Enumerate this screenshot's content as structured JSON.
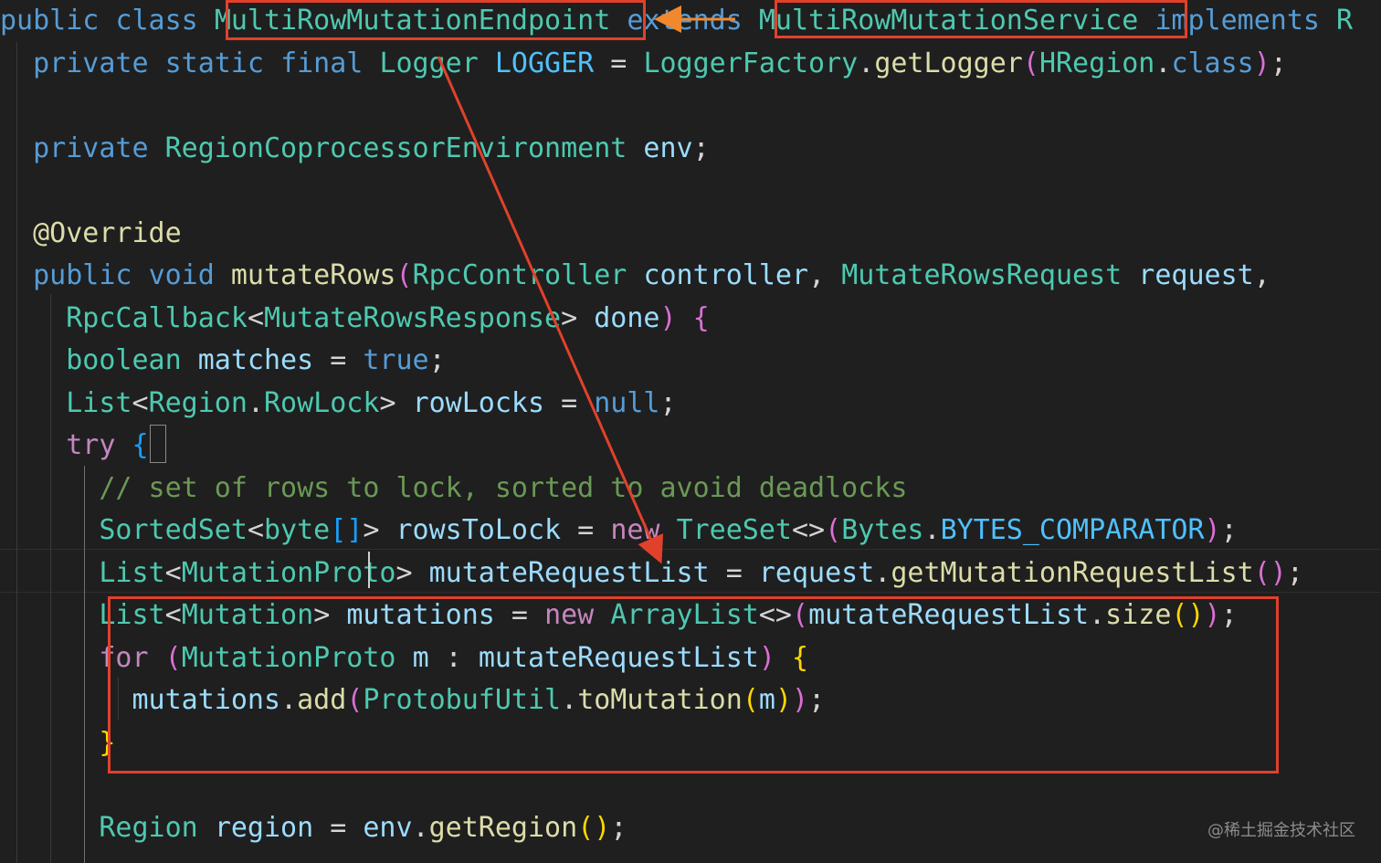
{
  "editor": {
    "cursor_line_index": 13,
    "lines": [
      {
        "tokens": [
          {
            "t": "public",
            "c": "kw"
          },
          {
            "t": " "
          },
          {
            "t": "class",
            "c": "kw"
          },
          {
            "t": " "
          },
          {
            "t": "MultiRowMutationEndpoint",
            "c": "type"
          },
          {
            "t": " "
          },
          {
            "t": "extends",
            "c": "kw"
          },
          {
            "t": " "
          },
          {
            "t": "MultiRowMutationService",
            "c": "type"
          },
          {
            "t": " "
          },
          {
            "t": "implements",
            "c": "kw"
          },
          {
            "t": " "
          },
          {
            "t": "R",
            "c": "type"
          }
        ]
      },
      {
        "tokens": [
          {
            "t": "  "
          },
          {
            "t": "private",
            "c": "kw"
          },
          {
            "t": " "
          },
          {
            "t": "static",
            "c": "kw"
          },
          {
            "t": " "
          },
          {
            "t": "final",
            "c": "kw"
          },
          {
            "t": " "
          },
          {
            "t": "Logger",
            "c": "type"
          },
          {
            "t": " "
          },
          {
            "t": "LOGGER",
            "c": "const"
          },
          {
            "t": " = ",
            "c": "pun"
          },
          {
            "t": "LoggerFactory",
            "c": "type"
          },
          {
            "t": ".",
            "c": "pun"
          },
          {
            "t": "getLogger",
            "c": "fn"
          },
          {
            "t": "(",
            "c": "b1"
          },
          {
            "t": "HRegion",
            "c": "type"
          },
          {
            "t": ".",
            "c": "pun"
          },
          {
            "t": "class",
            "c": "kw"
          },
          {
            "t": ")",
            "c": "b1"
          },
          {
            "t": ";",
            "c": "pun"
          }
        ]
      },
      {
        "tokens": []
      },
      {
        "tokens": [
          {
            "t": "  "
          },
          {
            "t": "private",
            "c": "kw"
          },
          {
            "t": " "
          },
          {
            "t": "RegionCoprocessorEnvironment",
            "c": "type"
          },
          {
            "t": " "
          },
          {
            "t": "env",
            "c": "var"
          },
          {
            "t": ";",
            "c": "pun"
          }
        ]
      },
      {
        "tokens": []
      },
      {
        "tokens": [
          {
            "t": "  "
          },
          {
            "t": "@Override",
            "c": "anno"
          }
        ]
      },
      {
        "tokens": [
          {
            "t": "  "
          },
          {
            "t": "public",
            "c": "kw"
          },
          {
            "t": " "
          },
          {
            "t": "void",
            "c": "kw"
          },
          {
            "t": " "
          },
          {
            "t": "mutateRows",
            "c": "fn"
          },
          {
            "t": "(",
            "c": "b1"
          },
          {
            "t": "RpcController",
            "c": "type"
          },
          {
            "t": " "
          },
          {
            "t": "controller",
            "c": "var"
          },
          {
            "t": ", ",
            "c": "pun"
          },
          {
            "t": "MutateRowsRequest",
            "c": "type"
          },
          {
            "t": " "
          },
          {
            "t": "request",
            "c": "var"
          },
          {
            "t": ",",
            "c": "pun"
          }
        ]
      },
      {
        "tokens": [
          {
            "t": "    "
          },
          {
            "t": "RpcCallback",
            "c": "type"
          },
          {
            "t": "<",
            "c": "pun"
          },
          {
            "t": "MutateRowsResponse",
            "c": "type"
          },
          {
            "t": "> ",
            "c": "pun"
          },
          {
            "t": "done",
            "c": "var"
          },
          {
            "t": ")",
            "c": "b1"
          },
          {
            "t": " "
          },
          {
            "t": "{",
            "c": "b1"
          }
        ]
      },
      {
        "tokens": [
          {
            "t": "    "
          },
          {
            "t": "boolean",
            "c": "type"
          },
          {
            "t": " "
          },
          {
            "t": "matches",
            "c": "var"
          },
          {
            "t": " = ",
            "c": "pun"
          },
          {
            "t": "true",
            "c": "kw"
          },
          {
            "t": ";",
            "c": "pun"
          }
        ]
      },
      {
        "tokens": [
          {
            "t": "    "
          },
          {
            "t": "List",
            "c": "type"
          },
          {
            "t": "<",
            "c": "pun"
          },
          {
            "t": "Region",
            "c": "type"
          },
          {
            "t": ".",
            "c": "pun"
          },
          {
            "t": "RowLock",
            "c": "type"
          },
          {
            "t": "> ",
            "c": "pun"
          },
          {
            "t": "rowLocks",
            "c": "var"
          },
          {
            "t": " = ",
            "c": "pun"
          },
          {
            "t": "null",
            "c": "kw"
          },
          {
            "t": ";",
            "c": "pun"
          }
        ]
      },
      {
        "tokens": [
          {
            "t": "    "
          },
          {
            "t": "try",
            "c": "ctrl"
          },
          {
            "t": " "
          },
          {
            "t": "{",
            "c": "b3"
          }
        ]
      },
      {
        "tokens": [
          {
            "t": "      "
          },
          {
            "t": "// set of rows to lock, sorted to avoid deadlocks",
            "c": "cmt"
          }
        ]
      },
      {
        "tokens": [
          {
            "t": "      "
          },
          {
            "t": "SortedSet",
            "c": "type"
          },
          {
            "t": "<",
            "c": "pun"
          },
          {
            "t": "byte",
            "c": "type"
          },
          {
            "t": "[]",
            "c": "b3"
          },
          {
            "t": "> ",
            "c": "pun"
          },
          {
            "t": "rowsToLock",
            "c": "var"
          },
          {
            "t": " = ",
            "c": "pun"
          },
          {
            "t": "new",
            "c": "ctrl"
          },
          {
            "t": " "
          },
          {
            "t": "TreeSet",
            "c": "type"
          },
          {
            "t": "<>",
            "c": "pun"
          },
          {
            "t": "(",
            "c": "b1"
          },
          {
            "t": "Bytes",
            "c": "type"
          },
          {
            "t": ".",
            "c": "pun"
          },
          {
            "t": "BYTES_COMPARATOR",
            "c": "const"
          },
          {
            "t": ")",
            "c": "b1"
          },
          {
            "t": ";",
            "c": "pun"
          }
        ]
      },
      {
        "tokens": [
          {
            "t": "      "
          },
          {
            "t": "List",
            "c": "type"
          },
          {
            "t": "<",
            "c": "pun"
          },
          {
            "t": "MutationProto",
            "c": "type"
          },
          {
            "t": "> ",
            "c": "pun"
          },
          {
            "t": "mutateRequestList",
            "c": "var"
          },
          {
            "t": " = ",
            "c": "pun"
          },
          {
            "t": "request",
            "c": "var"
          },
          {
            "t": ".",
            "c": "pun"
          },
          {
            "t": "getMutationRequestList",
            "c": "fn"
          },
          {
            "t": "()",
            "c": "b1"
          },
          {
            "t": ";",
            "c": "pun"
          }
        ]
      },
      {
        "tokens": [
          {
            "t": "      "
          },
          {
            "t": "List",
            "c": "type"
          },
          {
            "t": "<",
            "c": "pun"
          },
          {
            "t": "Mutation",
            "c": "type"
          },
          {
            "t": "> ",
            "c": "pun"
          },
          {
            "t": "mutations",
            "c": "var"
          },
          {
            "t": " = ",
            "c": "pun"
          },
          {
            "t": "new",
            "c": "ctrl"
          },
          {
            "t": " "
          },
          {
            "t": "ArrayList",
            "c": "type"
          },
          {
            "t": "<>",
            "c": "pun"
          },
          {
            "t": "(",
            "c": "b1"
          },
          {
            "t": "mutateRequestList",
            "c": "var"
          },
          {
            "t": ".",
            "c": "pun"
          },
          {
            "t": "size",
            "c": "fn"
          },
          {
            "t": "()",
            "c": "b2"
          },
          {
            "t": ")",
            "c": "b1"
          },
          {
            "t": ";",
            "c": "pun"
          }
        ]
      },
      {
        "tokens": [
          {
            "t": "      "
          },
          {
            "t": "for",
            "c": "ctrl"
          },
          {
            "t": " "
          },
          {
            "t": "(",
            "c": "b1"
          },
          {
            "t": "MutationProto",
            "c": "type"
          },
          {
            "t": " "
          },
          {
            "t": "m",
            "c": "var"
          },
          {
            "t": " : ",
            "c": "pun"
          },
          {
            "t": "mutateRequestList",
            "c": "var"
          },
          {
            "t": ")",
            "c": "b1"
          },
          {
            "t": " "
          },
          {
            "t": "{",
            "c": "b2"
          }
        ]
      },
      {
        "tokens": [
          {
            "t": "        "
          },
          {
            "t": "mutations",
            "c": "var"
          },
          {
            "t": ".",
            "c": "pun"
          },
          {
            "t": "add",
            "c": "fn"
          },
          {
            "t": "(",
            "c": "b1"
          },
          {
            "t": "ProtobufUtil",
            "c": "type"
          },
          {
            "t": ".",
            "c": "pun"
          },
          {
            "t": "toMutation",
            "c": "fn"
          },
          {
            "t": "(",
            "c": "b2"
          },
          {
            "t": "m",
            "c": "var"
          },
          {
            "t": ")",
            "c": "b2"
          },
          {
            "t": ")",
            "c": "b1"
          },
          {
            "t": ";",
            "c": "pun"
          }
        ]
      },
      {
        "tokens": [
          {
            "t": "      "
          },
          {
            "t": "}",
            "c": "b2"
          }
        ]
      },
      {
        "tokens": []
      },
      {
        "tokens": [
          {
            "t": "      "
          },
          {
            "t": "Region",
            "c": "type"
          },
          {
            "t": " "
          },
          {
            "t": "region",
            "c": "var"
          },
          {
            "t": " = ",
            "c": "pun"
          },
          {
            "t": "env",
            "c": "var"
          },
          {
            "t": ".",
            "c": "pun"
          },
          {
            "t": "getRegion",
            "c": "fn"
          },
          {
            "t": "()",
            "c": "b2"
          },
          {
            "t": ";",
            "c": "pun"
          }
        ]
      }
    ]
  },
  "watermark": "@稀土掘金技术社区",
  "colors": {
    "background": "#1f1f1f",
    "annotation_red": "#e1412b",
    "annotation_orange": "#f0882d"
  }
}
